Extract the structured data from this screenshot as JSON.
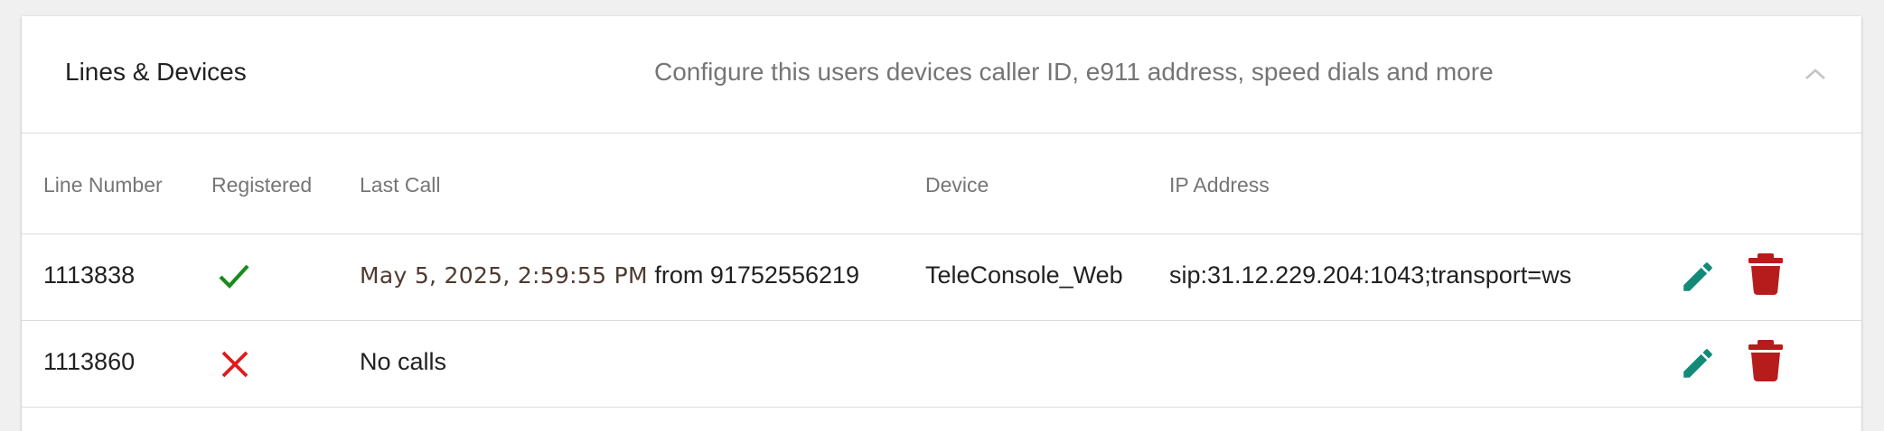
{
  "panel": {
    "title": "Lines & Devices",
    "description": "Configure this users devices caller ID, e911 address, speed dials and more",
    "collapse_icon": "chevron-up-icon"
  },
  "table": {
    "columns": [
      "Line Number",
      "Registered",
      "Last Call",
      "Device",
      "IP Address"
    ],
    "rows": [
      {
        "line_number": "1113838",
        "registered": true,
        "registered_icon": "checkmark-icon",
        "last_call_date": "May 5, 2025, 2:59:55 PM",
        "last_call_from": "from 91752556219",
        "device": "TeleConsole_Web",
        "ip_address": "sip:31.12.229.204:1043;transport=ws",
        "actions": [
          "edit-icon",
          "delete-icon"
        ]
      },
      {
        "line_number": "1113860",
        "registered": false,
        "registered_icon": "x-icon",
        "last_call_text": "No calls",
        "device": "",
        "ip_address": "",
        "actions": [
          "edit-icon",
          "delete-icon"
        ]
      }
    ]
  },
  "colors": {
    "registered_yes": "#1a8a1a",
    "registered_no": "#e01b1b",
    "edit": "#138a78",
    "delete": "#b71c1c"
  }
}
